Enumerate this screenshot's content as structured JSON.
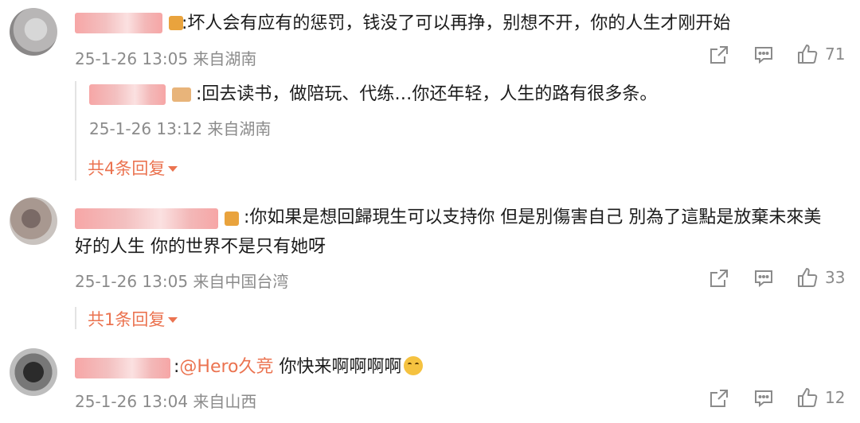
{
  "comments": [
    {
      "text": ":坏人会有应有的惩罚，钱没了可以再挣，别想不开，你的人生才刚开始",
      "meta": "25-1-26 13:05 来自湖南",
      "likes": "71",
      "reply": {
        "text": ":回去读书，做陪玩、代练…你还年轻，人生的路有很多条。",
        "meta": "25-1-26 13:12 来自湖南"
      },
      "more_replies": "共4条回复"
    },
    {
      "text_line1": ":你如果是想回歸現生可以支持你 但是別傷害自己 別為了這點是放棄未來美",
      "text_line2": "好的人生 你的世界不是只有她呀",
      "meta": "25-1-26 13:05 来自中国台湾",
      "likes": "33",
      "more_replies": "共1条回复"
    },
    {
      "prefix": ":",
      "mention": "@Hero久竞",
      "text": " 你快来啊啊啊啊",
      "meta": "25-1-26 13:04 来自山西",
      "likes": "12"
    }
  ],
  "colors": {
    "accent": "#eb7350",
    "meta": "#8b8b8b",
    "text": "#1b1b1b"
  },
  "icons": [
    "share-icon",
    "comment-icon",
    "like-icon",
    "chevron-down-icon",
    "crying-emoji-icon"
  ]
}
